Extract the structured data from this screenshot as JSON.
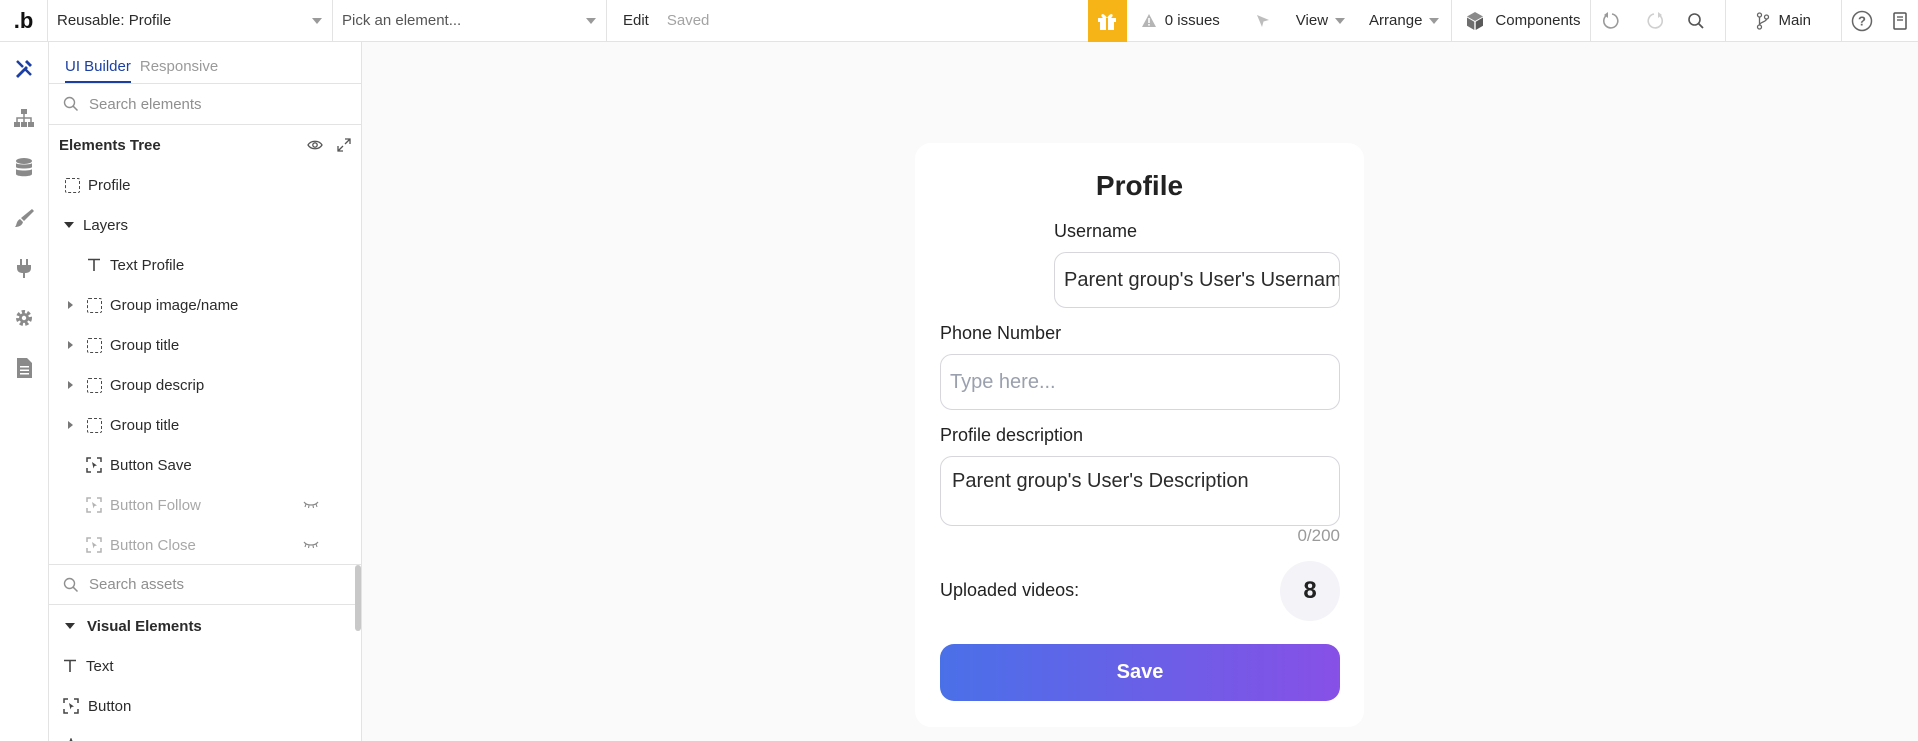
{
  "topbar": {
    "logo": "b",
    "page_selector": "Reusable: Profile",
    "element_picker": "Pick an element...",
    "edit_label": "Edit",
    "saved_label": "Saved",
    "issues": "0 issues",
    "view_label": "View",
    "arrange_label": "Arrange",
    "components_label": "Components",
    "branch_label": "Main"
  },
  "panel": {
    "tabs": [
      "UI Builder",
      "Responsive"
    ],
    "search_placeholder": "Search elements",
    "tree_title": "Elements Tree",
    "tree": [
      {
        "label": "Profile",
        "icon": "group-icon",
        "indent": 0
      },
      {
        "label": "Layers",
        "icon": "none",
        "indent": 0
      },
      {
        "label": "Text Profile",
        "icon": "text-icon",
        "indent": 1
      },
      {
        "label": "Group image/name",
        "icon": "group-icon",
        "indent": 1
      },
      {
        "label": "Group title",
        "icon": "group-icon",
        "indent": 1
      },
      {
        "label": "Group descrip",
        "icon": "group-icon",
        "indent": 1
      },
      {
        "label": "Group title",
        "icon": "group-icon",
        "indent": 1
      },
      {
        "label": "Button Save",
        "icon": "button-icon",
        "indent": 1
      },
      {
        "label": "Button Follow",
        "icon": "button-icon",
        "indent": 1,
        "hidden": true
      },
      {
        "label": "Button Close",
        "icon": "button-icon",
        "indent": 1,
        "hidden": true
      }
    ],
    "assets_search_placeholder": "Search assets",
    "visual_elements_title": "Visual Elements",
    "assets": [
      {
        "label": "Text",
        "icon": "text-icon"
      },
      {
        "label": "Button",
        "icon": "button-icon"
      }
    ]
  },
  "card": {
    "title": "Profile",
    "username_label": "Username",
    "username_value": "Parent group's User's Username",
    "phone_label": "Phone Number",
    "phone_placeholder": "Type here...",
    "description_label": "Profile description",
    "description_value": "Parent group's User's Description",
    "counter": "0/200",
    "videos_label": "Uploaded videos:",
    "videos_count": "8",
    "save_label": "Save"
  },
  "colors": {
    "accent": "#1b3fa3",
    "gift": "#f7b417",
    "save_gradient_start": "#4a70e8",
    "save_gradient_end": "#8750e6"
  }
}
